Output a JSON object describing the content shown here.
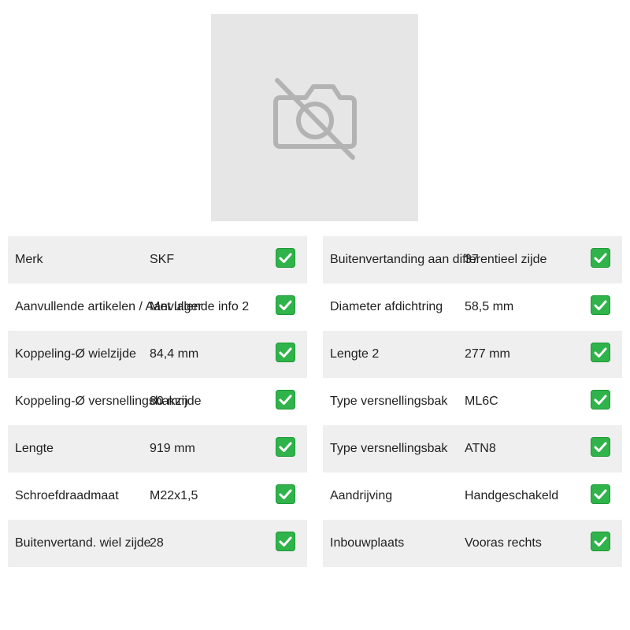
{
  "image": {
    "icon": "no-photo-icon"
  },
  "specs": {
    "left": [
      {
        "label": "Merk",
        "value": "SKF",
        "status": "check"
      },
      {
        "label": "Aanvullende artikelen / Aanvullende info 2",
        "value": "Met lager",
        "status": "check"
      },
      {
        "label": "Koppeling-Ø wielzijde",
        "value": "84,4 mm",
        "status": "check"
      },
      {
        "label": "Koppeling-Ø versnellingsbakzijde",
        "value": "80 mm",
        "status": "check"
      },
      {
        "label": "Lengte",
        "value": "919 mm",
        "status": "check"
      },
      {
        "label": "Schroefdraadmaat",
        "value": "M22x1,5",
        "status": "check"
      },
      {
        "label": "Buitenvertand. wiel zijde",
        "value": "28",
        "status": "check"
      }
    ],
    "right": [
      {
        "label": "Buitenvertanding aan differentieel zijde",
        "value": "37",
        "status": "check"
      },
      {
        "label": "Diameter afdichtring",
        "value": "58,5 mm",
        "status": "check"
      },
      {
        "label": "Lengte 2",
        "value": "277 mm",
        "status": "check"
      },
      {
        "label": "Type versnellingsbak",
        "value": "ML6C",
        "status": "check"
      },
      {
        "label": "Type versnellingsbak",
        "value": "ATN8",
        "status": "check"
      },
      {
        "label": "Aandrijving",
        "value": "Handgeschakeld",
        "status": "check"
      },
      {
        "label": "Inbouwplaats",
        "value": "Vooras rechts",
        "status": "check"
      }
    ]
  },
  "colors": {
    "check_green": "#2fb34a",
    "row_alt": "#efefef",
    "image_bg": "#e6e6e6"
  }
}
